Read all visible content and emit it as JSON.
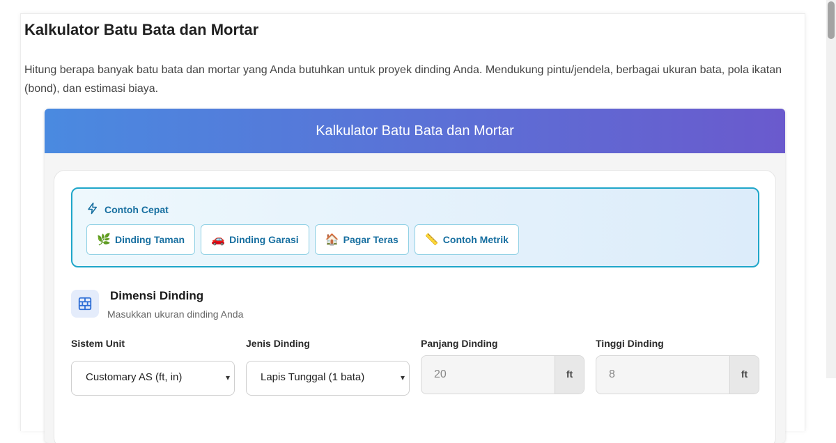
{
  "page": {
    "title": "Kalkulator Batu Bata dan Mortar",
    "description": "Hitung berapa banyak batu bata dan mortar yang Anda butuhkan untuk proyek dinding Anda. Mendukung pintu/jendela, berbagai ukuran bata, pola ikatan (bond), dan estimasi biaya."
  },
  "calculator": {
    "header": "Kalkulator Batu Bata dan Mortar",
    "quick_examples": {
      "title": "Contoh Cepat",
      "icon": "lightning-icon",
      "buttons": [
        {
          "emoji": "🌿",
          "label": "Dinding Taman"
        },
        {
          "emoji": "🚗",
          "label": "Dinding Garasi"
        },
        {
          "emoji": "🏠",
          "label": "Pagar Teras"
        },
        {
          "emoji": "📏",
          "label": "Contoh Metrik"
        }
      ]
    },
    "dimensions": {
      "icon": "brick-wall-icon",
      "title": "Dimensi Dinding",
      "subtitle": "Masukkan ukuran dinding Anda",
      "fields": {
        "unit_system": {
          "label": "Sistem Unit",
          "value": "Customary AS (ft, in)"
        },
        "wall_type": {
          "label": "Jenis Dinding",
          "value": "Lapis Tunggal (1 bata)"
        },
        "wall_length": {
          "label": "Panjang Dinding",
          "placeholder": "20",
          "unit": "ft"
        },
        "wall_height": {
          "label": "Tinggi Dinding",
          "placeholder": "8",
          "unit": "ft"
        }
      }
    }
  },
  "colors": {
    "header_gradient_start": "#4a8ae0",
    "header_gradient_end": "#6a5acd",
    "quick_accent": "#176fa0",
    "quick_border": "#1fa6c9"
  }
}
